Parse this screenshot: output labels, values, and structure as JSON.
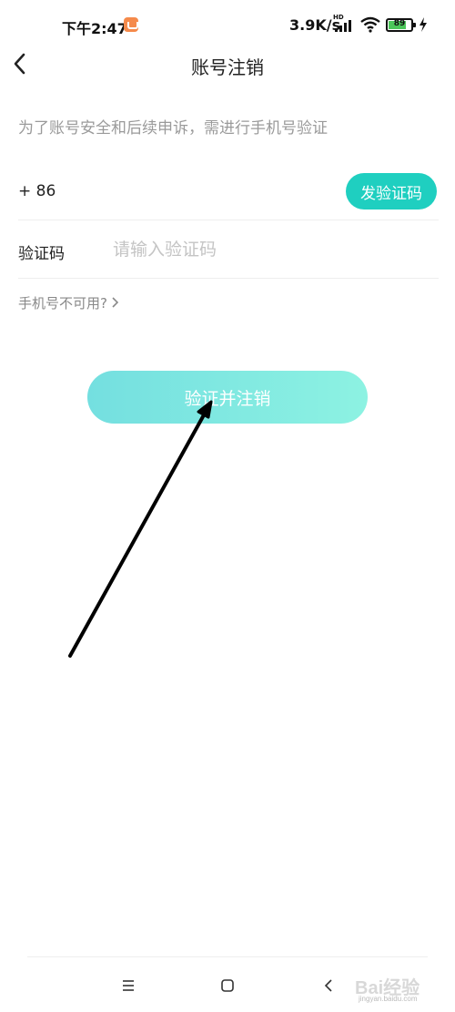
{
  "status_bar": {
    "time": "下午2:47",
    "network_speed": "3.9K/s",
    "network_type": "HD",
    "battery_level": "89",
    "icons": [
      "app-notification-icon",
      "signal-icon",
      "wifi-icon",
      "battery-icon",
      "charging-icon"
    ]
  },
  "header": {
    "title": "账号注销",
    "back_icon": "chevron-left-icon"
  },
  "hint": "为了账号安全和后续申诉，需进行手机号验证",
  "phone": {
    "country_code": "+ 86",
    "send_code_label": "发验证码"
  },
  "verification": {
    "label": "验证码",
    "placeholder": "请输入验证码"
  },
  "unavailable_link": "手机号不可用?",
  "primary_button": "验证并注销",
  "nav_bar": {
    "icons": [
      "menu-icon",
      "home-icon",
      "back-icon"
    ]
  },
  "watermark": {
    "text": "Bai经验",
    "sub": "jingyan.baidu.com"
  },
  "colors": {
    "accent": "#1fcfc0",
    "primary_button_start": "#74dfe0",
    "primary_button_end": "#8df2e2",
    "hint": "#9a9a9a"
  }
}
